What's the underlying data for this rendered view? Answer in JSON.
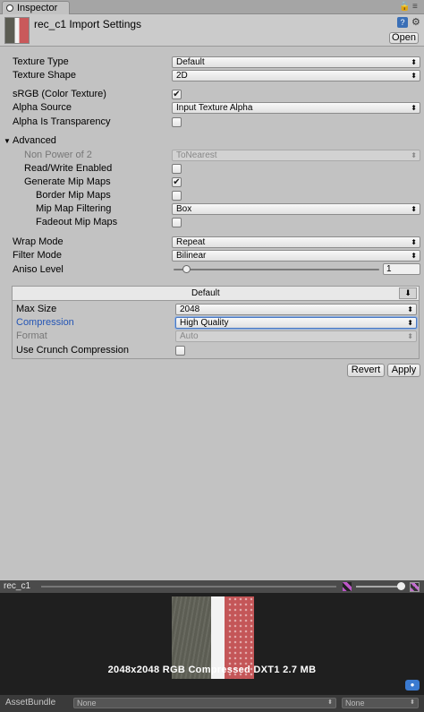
{
  "tab": {
    "label": "Inspector"
  },
  "header": {
    "title": "rec_c1 Import Settings",
    "open_label": "Open"
  },
  "fields": {
    "texture_type": {
      "label": "Texture Type",
      "value": "Default"
    },
    "texture_shape": {
      "label": "Texture Shape",
      "value": "2D"
    },
    "srgb": {
      "label": "sRGB (Color Texture)",
      "checked": true
    },
    "alpha_source": {
      "label": "Alpha Source",
      "value": "Input Texture Alpha"
    },
    "alpha_is_transparency": {
      "label": "Alpha Is Transparency",
      "checked": false
    },
    "advanced": {
      "label": "Advanced",
      "expanded": true
    },
    "npot": {
      "label": "Non Power of 2",
      "value": "ToNearest",
      "disabled": true
    },
    "read_write": {
      "label": "Read/Write Enabled",
      "checked": false
    },
    "gen_mips": {
      "label": "Generate Mip Maps",
      "checked": true
    },
    "border_mips": {
      "label": "Border Mip Maps",
      "checked": false
    },
    "mip_filter": {
      "label": "Mip Map Filtering",
      "value": "Box"
    },
    "fadeout_mips": {
      "label": "Fadeout Mip Maps",
      "checked": false
    },
    "wrap_mode": {
      "label": "Wrap Mode",
      "value": "Repeat"
    },
    "filter_mode": {
      "label": "Filter Mode",
      "value": "Bilinear"
    },
    "aniso": {
      "label": "Aniso Level",
      "value": "1",
      "slider_fraction": 0.06
    }
  },
  "platform": {
    "tab_label": "Default",
    "max_size": {
      "label": "Max Size",
      "value": "2048"
    },
    "compression": {
      "label": "Compression",
      "value": "High Quality"
    },
    "format": {
      "label": "Format",
      "value": "Auto",
      "disabled": true
    },
    "crunch": {
      "label": "Use Crunch Compression",
      "checked": false
    }
  },
  "actions": {
    "revert": "Revert",
    "apply": "Apply"
  },
  "preview": {
    "name": "rec_c1",
    "info": "2048x2048  RGB Compressed DXT1   2.7 MB"
  },
  "assetbundle": {
    "label": "AssetBundle",
    "name": "None",
    "variant": "None"
  },
  "icons": {
    "checkmark": "✔",
    "dropdown_arrow": "⬍",
    "foldout_open": "▼"
  }
}
